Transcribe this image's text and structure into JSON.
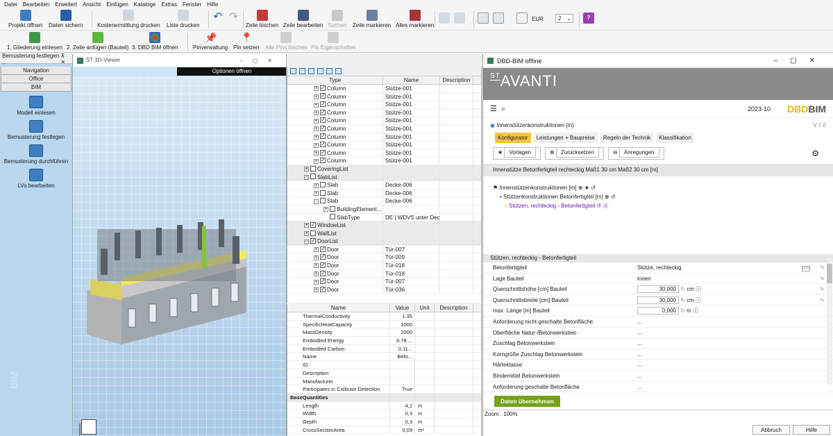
{
  "menu": [
    "Datei",
    "Bearbeiten",
    "Erweitert",
    "Ansicht",
    "Einfügen",
    "Kataloge",
    "Extras",
    "Fenster",
    "Hilfe"
  ],
  "toolbar1": {
    "open": "Projekt öffnen",
    "save": "Daten sichern",
    "cost": "Kostenermittlung drucken",
    "list": "Liste drucken",
    "delrow": "Zeile löschen",
    "editrow": "Zeile bearbeiten",
    "search": "Suchen",
    "markrow": "Zeile markieren",
    "markall": "Alles markieren",
    "currency": "EUR",
    "decimals": "2"
  },
  "toolbar2": {
    "outline": "1. Gliederung einlesen",
    "addrow": "2. Zeile anfügen (Bauteil)",
    "dbd": "3. DBD BIM öffnen",
    "pinmgmt": "Pinverwaltung",
    "pinset": "Pin setzen",
    "pinsdel": "Alle Pins löschen",
    "pinprops": "Pin Eigenschaften"
  },
  "left": {
    "title": "Bemusterung festlegen ...",
    "tabs": [
      "Navigation",
      "Office",
      "BIM"
    ],
    "items": [
      "Modell einlesen",
      "Bemusterung festlegen",
      "Bemusterung durchführen",
      "LVs bearbeiten"
    ],
    "watermark": "BIM"
  },
  "viewer": {
    "title": "ST 3D-Viewer",
    "options": "Optionen öffnen"
  },
  "tree": {
    "cols": [
      "Type",
      "Name",
      "Description"
    ],
    "rows": [
      {
        "ind": 2,
        "pm": "+",
        "cb": true,
        "t": "Column",
        "n": "Stütze-001"
      },
      {
        "ind": 2,
        "pm": "+",
        "cb": true,
        "t": "Column",
        "n": "Stütze-001"
      },
      {
        "ind": 2,
        "pm": "+",
        "cb": true,
        "t": "Column",
        "n": "Stütze-001"
      },
      {
        "ind": 2,
        "pm": "+",
        "cb": true,
        "t": "Column",
        "n": "Stütze-001"
      },
      {
        "ind": 2,
        "pm": "+",
        "cb": true,
        "t": "Column",
        "n": "Stütze-001"
      },
      {
        "ind": 2,
        "pm": "+",
        "cb": true,
        "t": "Column",
        "n": "Stütze-001"
      },
      {
        "ind": 2,
        "pm": "+",
        "cb": true,
        "t": "Column",
        "n": "Stütze-001"
      },
      {
        "ind": 2,
        "pm": "+",
        "cb": true,
        "t": "Column",
        "n": "Stütze-001"
      },
      {
        "ind": 2,
        "pm": "+",
        "cb": true,
        "t": "Column",
        "n": "Stütze-001"
      },
      {
        "ind": 2,
        "pm": "+",
        "cb": true,
        "t": "Column",
        "n": "Stütze-001"
      },
      {
        "ind": 1,
        "pm": "+",
        "cb": false,
        "t": "CoveringList",
        "n": "",
        "g": true
      },
      {
        "ind": 1,
        "pm": "-",
        "cb": false,
        "t": "SlabList",
        "n": "",
        "g": true
      },
      {
        "ind": 2,
        "pm": "+",
        "cb": false,
        "t": "Slab",
        "n": "Decke-006"
      },
      {
        "ind": 2,
        "pm": "+",
        "cb": false,
        "t": "Slab",
        "n": "Decke-006"
      },
      {
        "ind": 2,
        "pm": "-",
        "cb": false,
        "t": "Slab",
        "n": "Decke-006"
      },
      {
        "ind": 3,
        "pm": "+",
        "cb": false,
        "t": "BuildingElement...",
        "n": ""
      },
      {
        "ind": 3,
        "pm": "",
        "cb": false,
        "t": "SlabType",
        "n": "DE | WDVS unter Dec..."
      },
      {
        "ind": 1,
        "pm": "+",
        "cb": true,
        "t": "WindowList",
        "n": "",
        "g": true
      },
      {
        "ind": 1,
        "pm": "+",
        "cb": false,
        "t": "WallList",
        "n": "",
        "g": true
      },
      {
        "ind": 1,
        "pm": "-",
        "cb": true,
        "t": "DoorList",
        "n": "",
        "g": true
      },
      {
        "ind": 2,
        "pm": "+",
        "cb": true,
        "t": "Door",
        "n": "Tür-007"
      },
      {
        "ind": 2,
        "pm": "+",
        "cb": true,
        "t": "Door",
        "n": "Tür-009"
      },
      {
        "ind": 2,
        "pm": "+",
        "cb": true,
        "t": "Door",
        "n": "Tür-018"
      },
      {
        "ind": 2,
        "pm": "+",
        "cb": true,
        "t": "Door",
        "n": "Tür-018"
      },
      {
        "ind": 2,
        "pm": "+",
        "cb": true,
        "t": "Door",
        "n": "Tür-007"
      },
      {
        "ind": 2,
        "pm": "+",
        "cb": true,
        "t": "Door",
        "n": "Tür-036"
      }
    ]
  },
  "props": {
    "cols": [
      "Name",
      "Value",
      "Unit",
      "Description"
    ],
    "rows": [
      {
        "n": "ThermalConductivity",
        "v": "1.35",
        "u": ""
      },
      {
        "n": "SpecificHeatCapacity",
        "v": "1000",
        "u": ""
      },
      {
        "n": "MassDensity",
        "v": "2000",
        "u": ""
      },
      {
        "n": "Embodied Energy",
        "v": "0.78 ...",
        "u": ""
      },
      {
        "n": "Embodied Carbon",
        "v": "0.11...",
        "u": ""
      },
      {
        "n": "Name",
        "v": "Beto...",
        "u": ""
      },
      {
        "n": "ID",
        "v": "",
        "u": ""
      },
      {
        "n": "Description",
        "v": "",
        "u": ""
      },
      {
        "n": "Manufacturer",
        "v": "",
        "u": ""
      },
      {
        "n": "Participates in Collision Detection",
        "v": "True",
        "u": ""
      },
      {
        "n": "BaseQuantities",
        "v": "",
        "u": "",
        "g": true
      },
      {
        "n": "Length",
        "v": "4,2",
        "u": "m"
      },
      {
        "n": "Width",
        "v": "0,3",
        "u": "m"
      },
      {
        "n": "Depth",
        "v": "0,3",
        "u": "m"
      },
      {
        "n": "CrossSectionArea",
        "v": "0,09",
        "u": "m²"
      }
    ]
  },
  "dbd": {
    "title": "DBD-BIM offline",
    "brand": "AVANTI",
    "brand_st": "ST",
    "year": "2023-10",
    "bim_a": "DBD",
    "bim_b": "BIM",
    "breadcrumb": "Innenstützenkonstruktionen [m]",
    "version": "V 7.0",
    "tabs": [
      "Konfigurator",
      "Leistungen + Baupreise",
      "Regeln der Technik",
      "Klassifikation"
    ],
    "buttons": [
      "Vorlagen",
      "Zurücksetzen",
      "Anregungen"
    ],
    "headline": "Innenstütze Betonfertigteil rechteckig Maß1 30 cm Maß2 30 cm [m]",
    "tree": [
      "Innenstützenkonstruktionen [m]",
      "Stützenkonstruktionen Betonfertigteil [m]",
      "Stützen, rechteckig - Betonfertigteil"
    ],
    "section": "Stützen, rechteckig - Betonfertigteil",
    "rows": [
      {
        "l": "Betonfertigteil",
        "v": "Stütze, rechteckig",
        "din": "DIN"
      },
      {
        "l": "Lage Bauteil",
        "v": "innen"
      },
      {
        "l": "Querschnittshöhe [cm] Bauteil",
        "num": "30,000",
        "u": "cm"
      },
      {
        "l": "Querschnittsbreite [cm] Bauteil",
        "num": "30,000",
        "u": "cm"
      },
      {
        "l": "max. Länge [m] Bauteil",
        "num": "0,000",
        "u": "m"
      },
      {
        "l": "Anforderung nicht geschalte Betonfläche",
        "v": "..."
      },
      {
        "l": "Oberfläche Natur-/Betonwerkstein",
        "v": "..."
      },
      {
        "l": "Zuschlag Betonwerkstein",
        "v": "..."
      },
      {
        "l": "Korngröße Zuschlag Betonwerkstein",
        "v": "..."
      },
      {
        "l": "Härteklasse",
        "v": "..."
      },
      {
        "l": "Bindemittel Betonwerkstein",
        "v": "..."
      },
      {
        "l": "Anforderung geschalte Betonfläche",
        "v": "..."
      }
    ],
    "apply": "Daten übernehmen",
    "zoom": "Zoom : 100%",
    "cancel": "Abbruch",
    "help": "Hilfe"
  }
}
